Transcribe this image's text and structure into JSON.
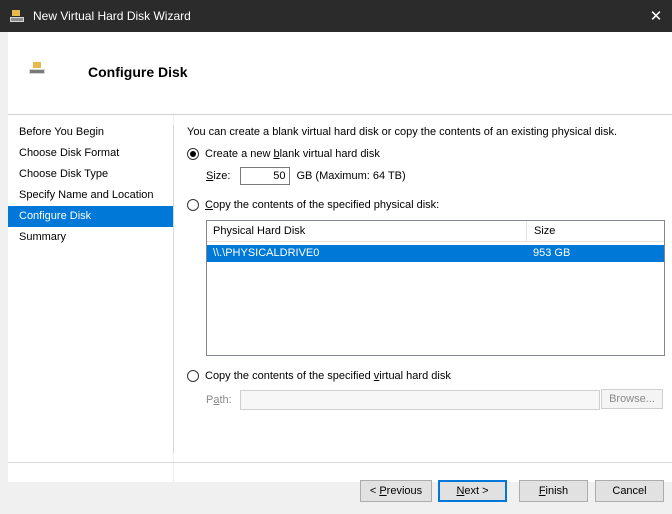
{
  "window": {
    "title": "New Virtual Hard Disk Wizard",
    "close_glyph": "✕"
  },
  "header": {
    "title": "Configure Disk"
  },
  "nav": {
    "items": [
      {
        "label": "Before You Begin"
      },
      {
        "label": "Choose Disk Format"
      },
      {
        "label": "Choose Disk Type"
      },
      {
        "label": "Specify Name and Location"
      },
      {
        "label": "Configure Disk"
      },
      {
        "label": "Summary"
      }
    ]
  },
  "content": {
    "intro": "You can create a blank virtual hard disk or copy the contents of an existing physical disk.",
    "option_new": {
      "pre": "Create a new ",
      "key": "b",
      "post": "lank virtual hard disk"
    },
    "size": {
      "label_key": "S",
      "label_post": "ize:",
      "value": "50",
      "unit_note": "GB (Maximum: 64 TB)"
    },
    "option_physical": {
      "key": "C",
      "post": "opy the contents of the specified physical disk:"
    },
    "table": {
      "headers": [
        "Physical Hard Disk",
        "Size"
      ],
      "rows": [
        {
          "disk": "\\\\.\\PHYSICALDRIVE0",
          "size": "953 GB"
        }
      ]
    },
    "option_virtual": {
      "pre": "Copy the contents of the specified ",
      "key": "v",
      "post": "irtual hard disk"
    },
    "path": {
      "label_pre": "P",
      "label_key": "a",
      "label_post": "th:",
      "value": ""
    },
    "browse_label": "Browse..."
  },
  "buttons": {
    "previous": {
      "pre": "< ",
      "key": "P",
      "post": "revious"
    },
    "next": {
      "key": "N",
      "post": "ext >"
    },
    "finish": {
      "key": "F",
      "post": "inish"
    },
    "cancel": "Cancel"
  },
  "colors": {
    "accent": "#0078d7",
    "titlebar": "#2b2b2b"
  }
}
